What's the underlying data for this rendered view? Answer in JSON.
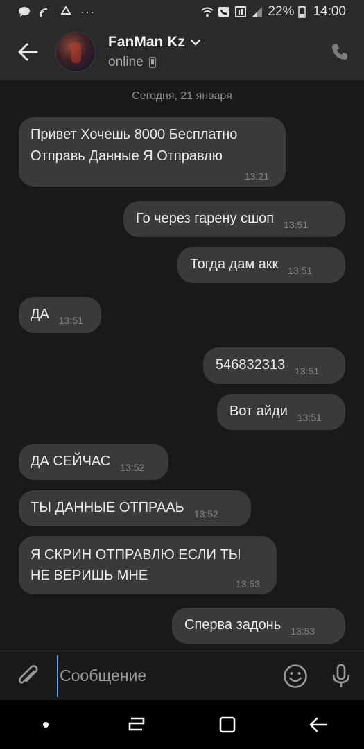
{
  "status_bar": {
    "battery": "22%",
    "time": "14:00"
  },
  "header": {
    "contact_name": "FanMan Kz",
    "status": "online"
  },
  "chat": {
    "date_separator": "Сегодня, 21 января",
    "messages": [
      {
        "direction": "in",
        "lines": [
          "Привет Хочешь 8000 Бесплатно",
          "Отправь Данные Я Отправлю"
        ],
        "time": "13:21"
      },
      {
        "direction": "out",
        "text": "Го через гарену сшоп",
        "time": "13:51"
      },
      {
        "direction": "out",
        "text": "Тогда дам акк",
        "time": "13:51"
      },
      {
        "direction": "in",
        "text": "ДА",
        "time": "13:51"
      },
      {
        "direction": "out",
        "text": "546832313",
        "time": "13:51"
      },
      {
        "direction": "out",
        "text": "Вот айди",
        "time": "13:51"
      },
      {
        "direction": "in",
        "text": "ДА СЕЙЧАС",
        "time": "13:52"
      },
      {
        "direction": "in",
        "text": "ТЫ ДАННЫЕ ОТПРААЬ",
        "time": "13:52"
      },
      {
        "direction": "in",
        "lines": [
          "Я СКРИН ОТПРАВЛЮ ЕСЛИ ТЫ",
          "НЕ ВЕРИШЬ МНЕ"
        ],
        "time": "13:53"
      },
      {
        "direction": "out",
        "text": "Сперва задонь",
        "time": "13:53"
      }
    ]
  },
  "input": {
    "placeholder": "Сообщение",
    "value": ""
  },
  "colors": {
    "background": "#19191a",
    "bar": "#2a2a2c",
    "bubble": "#3a3a3c",
    "accent": "#5ea1ff"
  },
  "icons": {
    "status_left": [
      "chat-icon",
      "nfc-icon",
      "recycle-icon",
      "more-icon"
    ],
    "status_right": [
      "wifi-icon",
      "call-icon",
      "sim-icon",
      "signal-icon",
      "battery-icon"
    ],
    "header": [
      "back-arrow-icon",
      "chevron-down-icon",
      "phone-status-icon",
      "phone-icon"
    ],
    "input_bar": [
      "paperclip-icon",
      "emoji-icon",
      "microphone-icon"
    ],
    "nav_bar": [
      "dot-icon",
      "recents-icon",
      "home-icon",
      "back-icon"
    ]
  }
}
